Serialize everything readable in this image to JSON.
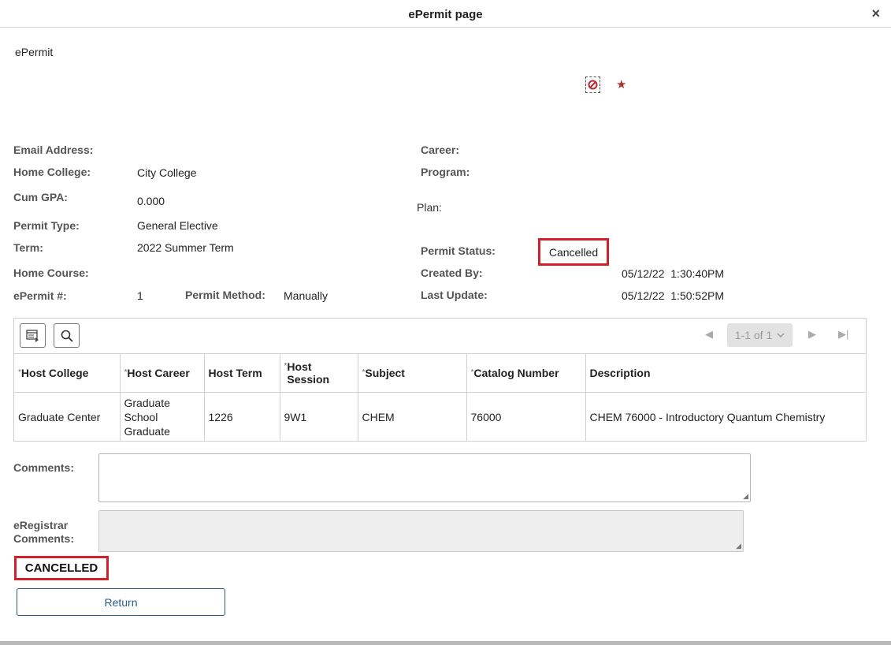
{
  "window": {
    "title": "ePermit page",
    "close_glyph": "×"
  },
  "page_label": "ePermit",
  "icons": {
    "no_entry": "no-entry-icon",
    "star": "star-icon",
    "star_color": "#b03030"
  },
  "fields": {
    "email_label": "Email Address:",
    "home_college_label": "Home College:",
    "home_college_value": "City College",
    "cum_gpa_label": "Cum GPA:",
    "cum_gpa_value": "0.000",
    "permit_type_label": "Permit Type:",
    "permit_type_value": "General Elective",
    "term_label": "Term:",
    "term_value": "2022 Summer Term",
    "home_course_label": "Home Course:",
    "epermit_num_label": "ePermit #:",
    "epermit_num_value": "1",
    "permit_method_label": "Permit Method:",
    "permit_method_value": "Manually",
    "career_label": "Career:",
    "program_label": "Program:",
    "plan_label": "Plan:",
    "permit_status_label": "Permit Status:",
    "permit_status_value": "Cancelled",
    "created_by_label": "Created By:",
    "created_by_value": "05/12/22  1:30:40PM",
    "last_update_label": "Last Update:",
    "last_update_value": "05/12/22  1:50:52PM"
  },
  "grid": {
    "pager_text": "1-1 of 1",
    "required_mark": "*",
    "columns": [
      "Host College",
      "Host Career",
      "Host Term",
      "Host Session",
      "Subject",
      "Catalog Number",
      "Description"
    ],
    "rows": [
      [
        "Graduate Center",
        "Graduate School Graduate",
        "1226",
        "9W1",
        "CHEM",
        "76000",
        "CHEM 76000 - Introductory Quantum Chemistry"
      ]
    ]
  },
  "comments": {
    "label": "Comments:",
    "value": ""
  },
  "eregistrar": {
    "label": "eRegistrar Comments:",
    "value": ""
  },
  "status_banner": "CANCELLED",
  "return_label": "Return",
  "colors": {
    "highlight": "#d4202a",
    "link_blue": "#2b5d8a"
  }
}
